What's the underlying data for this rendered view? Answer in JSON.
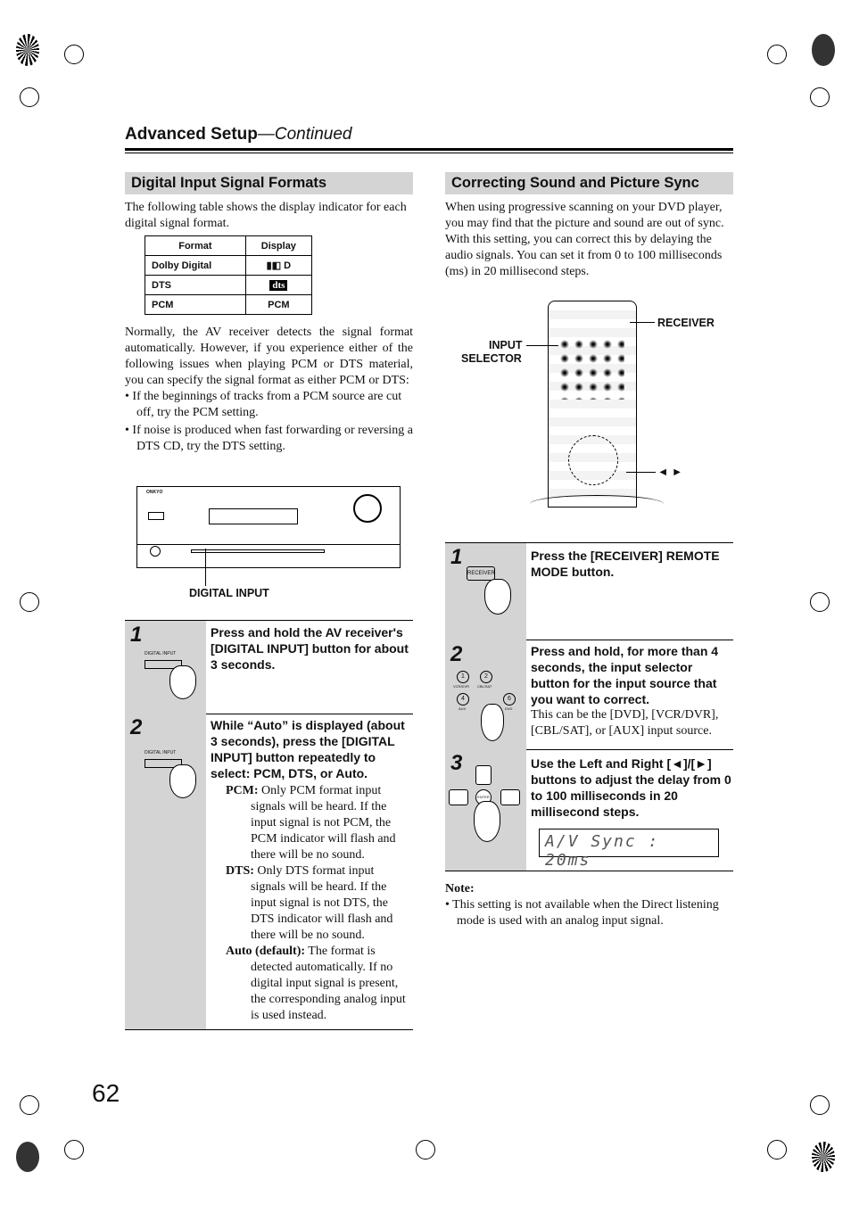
{
  "header": {
    "title": "Advanced Setup",
    "subtitle": "—Continued"
  },
  "left": {
    "section_title": "Digital Input Signal Formats",
    "intro": "The following table shows the display indicator for each digital signal format.",
    "table": {
      "headers": [
        "Format",
        "Display"
      ],
      "rows": [
        [
          "Dolby Digital",
          "D"
        ],
        [
          "DTS",
          "dts"
        ],
        [
          "PCM",
          "PCM"
        ]
      ]
    },
    "para": "Normally, the AV receiver detects the signal format automatically. However, if you experience either of the following issues when playing PCM or DTS material, you can specify the signal format as either PCM or DTS:",
    "bullets": [
      "If the beginnings of tracks from a PCM source are cut off, try the PCM setting.",
      "If noise is produced when fast forwarding or reversing a DTS CD, try the DTS setting."
    ],
    "receiver_brand": "ONKYO",
    "digital_input_callout": "DIGITAL INPUT",
    "steps": [
      {
        "num": "1",
        "button_label": "DIGITAL INPUT",
        "text": "Press and hold the AV receiver's [DIGITAL INPUT] button for about 3 seconds."
      },
      {
        "num": "2",
        "button_label": "DIGITAL INPUT",
        "text": "While “Auto” is displayed (about 3 seconds), press the [DIGITAL INPUT] button repeatedly to select: PCM, DTS, or Auto.",
        "options": [
          {
            "term": "PCM:",
            "desc": "Only PCM format input signals will be heard. If the input signal is not PCM, the PCM indicator will flash and there will be no sound."
          },
          {
            "term": "DTS:",
            "desc": "Only DTS format input signals will be heard. If the input signal is not DTS, the DTS indicator will flash and there will be no sound."
          },
          {
            "term": "Auto (default):",
            "desc": "The format is detected automatically. If no digital input signal is present, the corresponding analog input is used instead."
          }
        ]
      }
    ]
  },
  "right": {
    "section_title": "Correcting Sound and Picture Sync",
    "intro": "When using progressive scanning on your DVD player, you may find that the picture and sound are out of sync. With this setting, you can correct this by delaying the audio signals. You can set it from 0 to 100 milliseconds (ms) in 20 millisecond steps.",
    "callouts": {
      "receiver": "RECEIVER",
      "input": "INPUT",
      "selector": "SELECTOR",
      "arrows": "◄ ►"
    },
    "steps": [
      {
        "num": "1",
        "button_label": "RECEIVER",
        "text": "Press the [RECEIVER] REMOTE MODE button."
      },
      {
        "num": "2",
        "text": "Press and hold, for more than 4 seconds, the input selector button for the input source that you want to correct.",
        "sub": "This can be the [DVD], [VCR/DVR], [CBL/SAT], or [AUX] input source.",
        "keys": [
          "1",
          "2",
          "4",
          "6"
        ],
        "key_labels": [
          "VCR/DVR",
          "CBL/SAT",
          "AUX",
          "DVD"
        ]
      },
      {
        "num": "3",
        "text": "Use the Left and Right [◄]/[►] buttons to adjust the delay from 0 to 100 milliseconds in 20 millisecond steps.",
        "enter": "ENTER",
        "display": "A/V Sync : 20ms"
      }
    ],
    "note_title": "Note:",
    "note": "This setting is not available when the Direct listening mode is used with an analog input signal."
  },
  "page_number": "62"
}
